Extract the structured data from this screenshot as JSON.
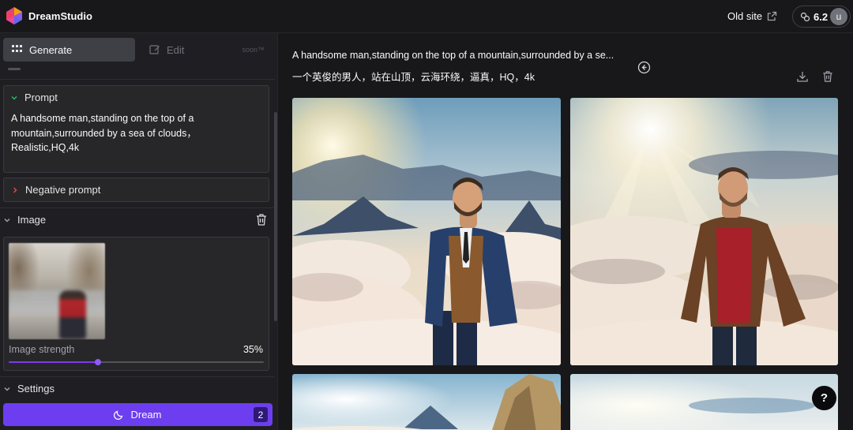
{
  "app": {
    "title": "DreamStudio"
  },
  "header": {
    "old_site_label": "Old site",
    "credits": "6.2",
    "avatar_initial": "u"
  },
  "tabs": {
    "generate": "Generate",
    "edit": "Edit",
    "edit_badge": "soon™"
  },
  "prompt": {
    "header": "Prompt",
    "text": "A handsome man,standing on the top of a\nmountain,surrounded by a sea of clouds，\nRealistic,HQ,4k"
  },
  "negative_prompt": {
    "header": "Negative prompt"
  },
  "image": {
    "header": "Image",
    "strength_label": "Image strength",
    "strength_value": "35%",
    "strength_fraction": 0.35
  },
  "settings": {
    "header": "Settings"
  },
  "dream": {
    "label": "Dream",
    "count": "2"
  },
  "result": {
    "title_en": "A handsome man,standing on the top of a mountain,surrounded by a se...",
    "title_cn": "一个英俊的男人，站在山顶，云海环绕，逼真，HQ，4k"
  },
  "help": {
    "label": "?"
  },
  "colors": {
    "accent": "#6d3ef0",
    "background": "#18181b",
    "panel": "#1f1f23"
  }
}
